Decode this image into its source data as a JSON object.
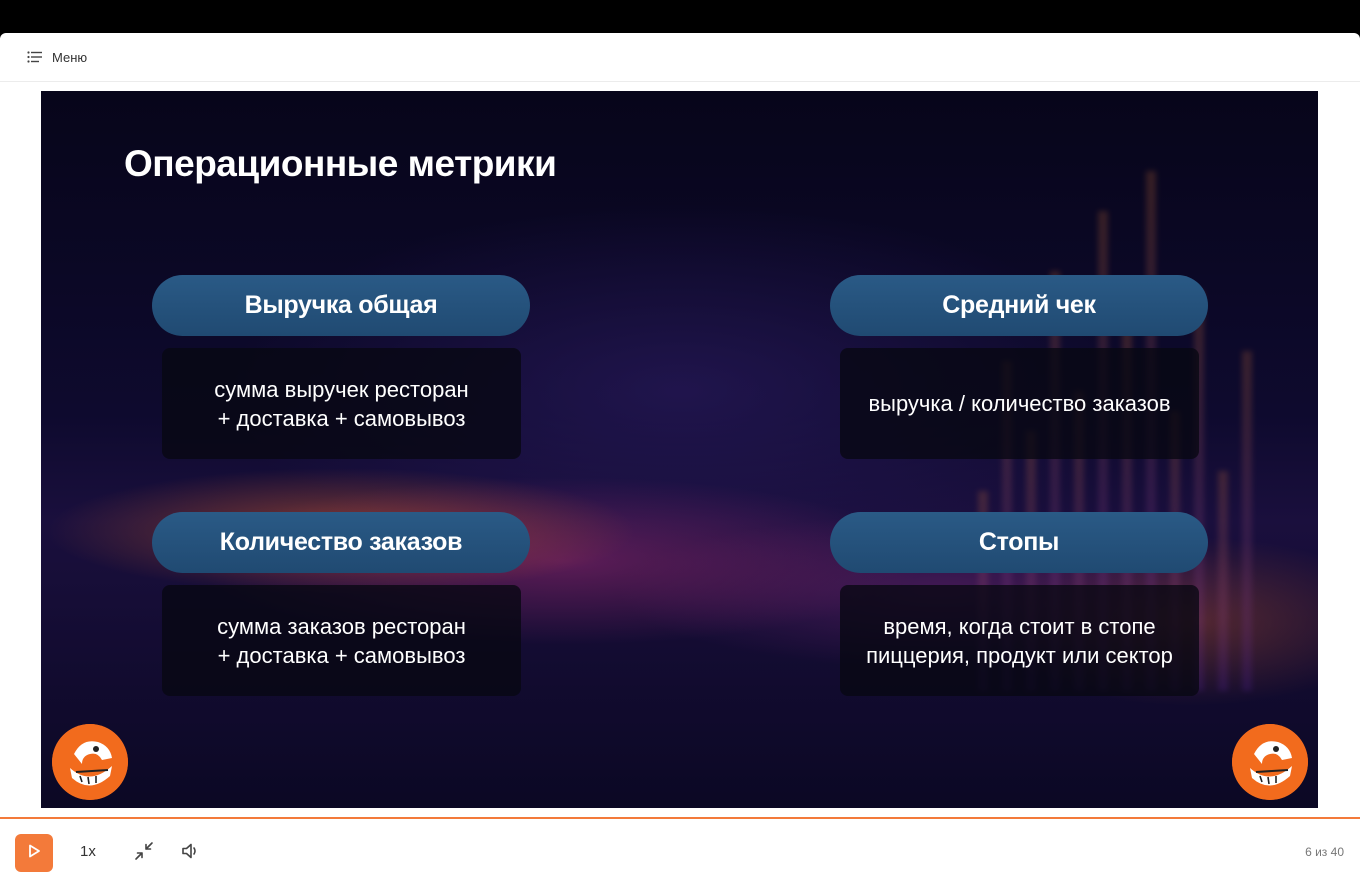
{
  "menu": {
    "label": "Меню"
  },
  "slide": {
    "title": "Операционные метрики",
    "metrics": [
      {
        "heading": "Выручка общая",
        "description": "сумма выручек ресторан\n+ доставка + самовывоз"
      },
      {
        "heading": "Средний чек",
        "description": "выручка / количество заказов"
      },
      {
        "heading": "Количество заказов",
        "description": "сумма заказов ресторан\n+ доставка + самовывоз"
      },
      {
        "heading": "Стопы",
        "description": "время, когда стоит в стопе пиццерия, продукт или сектор"
      }
    ]
  },
  "player": {
    "speed": "1x",
    "counter": "6 из 40",
    "icons": [
      "play-icon",
      "collapse-icon",
      "volume-icon",
      "menu-list-icon"
    ],
    "accent_color": "#f37a3a"
  }
}
